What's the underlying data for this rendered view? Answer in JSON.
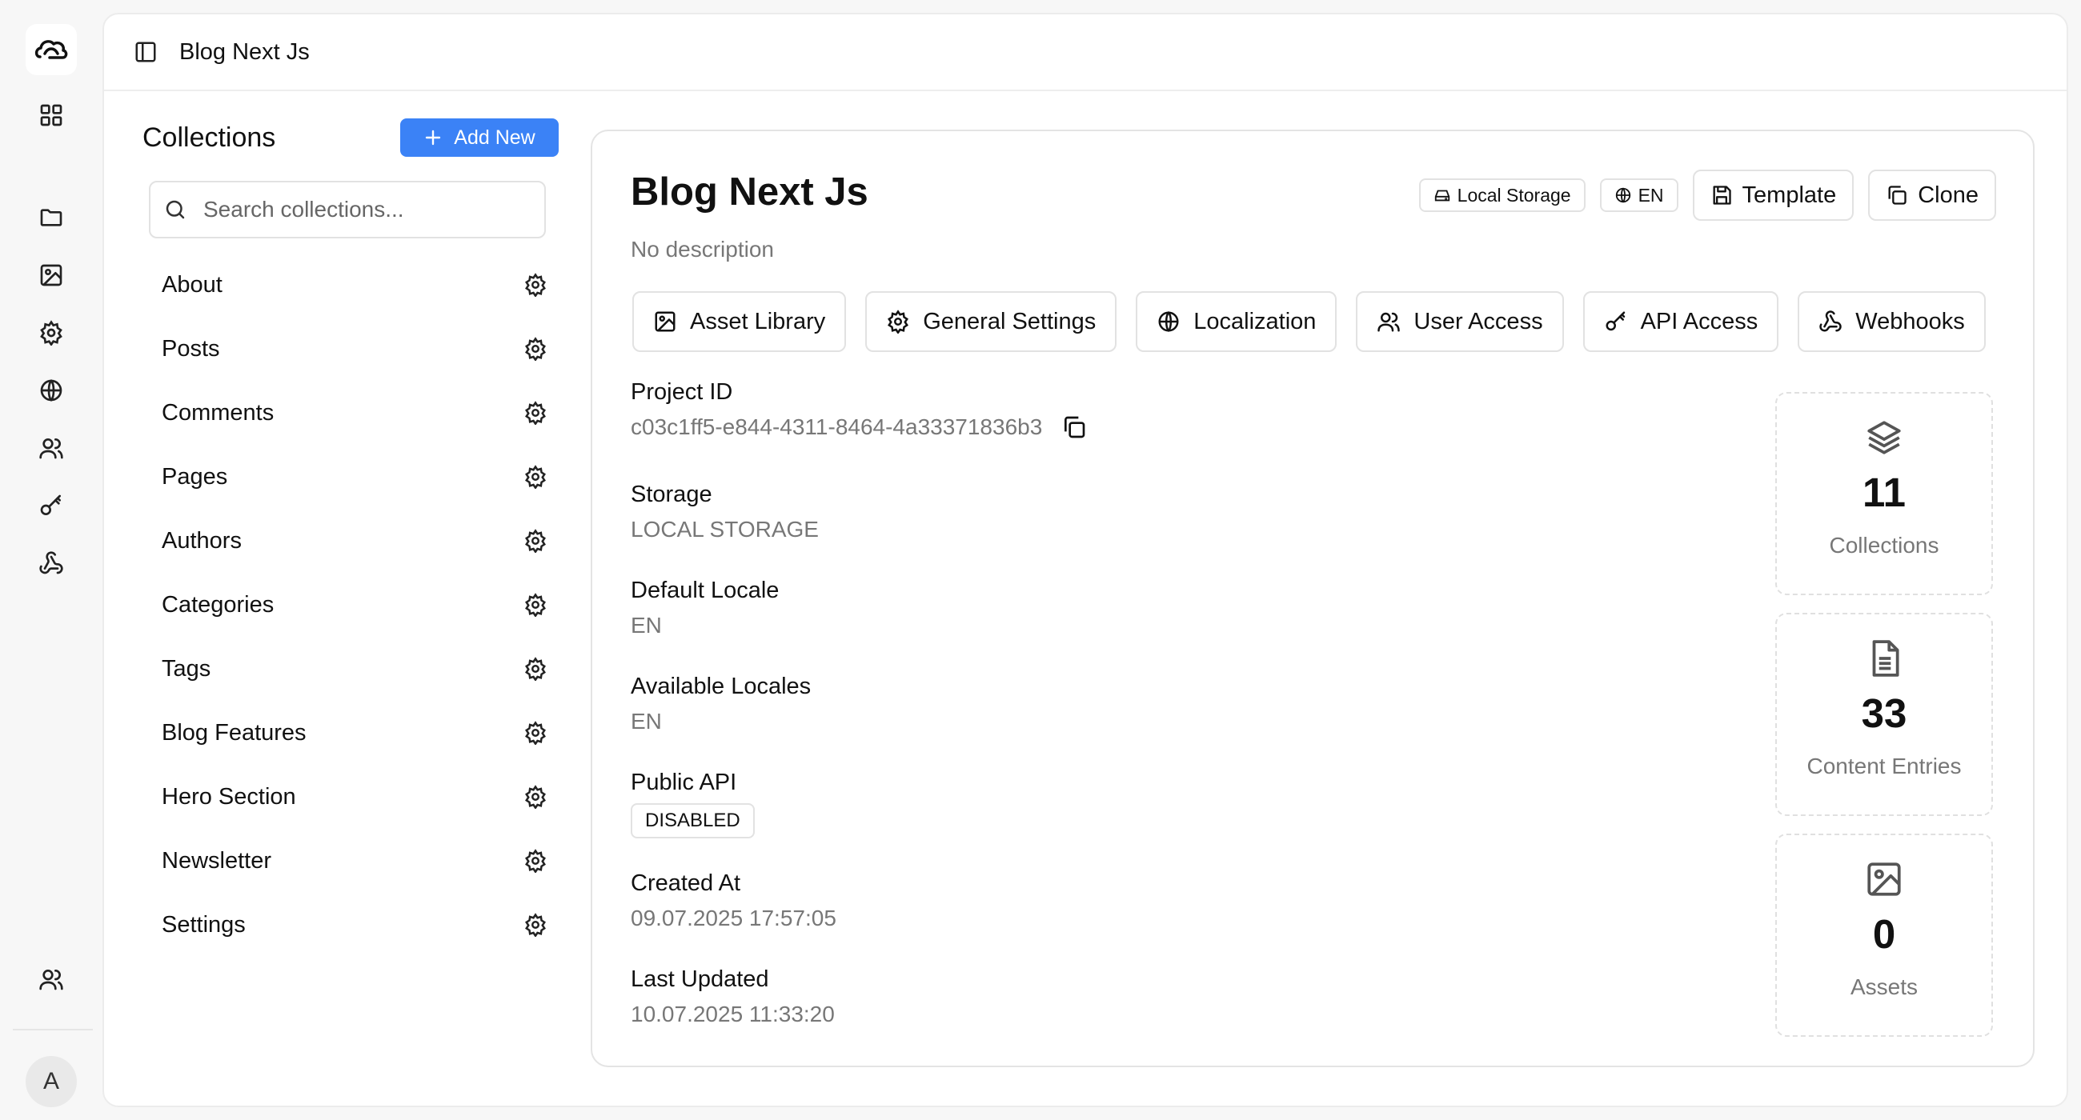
{
  "rail": {
    "icons": [
      "dashboard-icon",
      "folder-icon",
      "image-icon",
      "settings-icon",
      "globe-icon",
      "users-icon",
      "key-icon",
      "webhook-icon"
    ],
    "bottom_icon": "users-icon",
    "avatar_letter": "A"
  },
  "topbar": {
    "title": "Blog Next Js"
  },
  "collections": {
    "heading": "Collections",
    "add_label": "Add New",
    "search_placeholder": "Search collections...",
    "items": [
      {
        "label": "About"
      },
      {
        "label": "Posts"
      },
      {
        "label": "Comments"
      },
      {
        "label": "Pages"
      },
      {
        "label": "Authors"
      },
      {
        "label": "Categories"
      },
      {
        "label": "Tags"
      },
      {
        "label": "Blog Features"
      },
      {
        "label": "Hero Section"
      },
      {
        "label": "Newsletter"
      },
      {
        "label": "Settings"
      }
    ]
  },
  "project": {
    "title": "Blog Next Js",
    "description": "No description",
    "storage_pill": "Local Storage",
    "locale_pill": "EN",
    "template_label": "Template",
    "clone_label": "Clone",
    "tabs": [
      {
        "label": "Asset Library",
        "icon": "image-icon"
      },
      {
        "label": "General Settings",
        "icon": "settings-icon"
      },
      {
        "label": "Localization",
        "icon": "globe-icon"
      },
      {
        "label": "User Access",
        "icon": "users-icon"
      },
      {
        "label": "API Access",
        "icon": "key-icon"
      },
      {
        "label": "Webhooks",
        "icon": "webhook-icon"
      }
    ],
    "fields": {
      "project_id_label": "Project ID",
      "project_id_value": "c03c1ff5-e844-4311-8464-4a33371836b3",
      "storage_label": "Storage",
      "storage_value": "LOCAL STORAGE",
      "default_locale_label": "Default Locale",
      "default_locale_value": "EN",
      "available_locales_label": "Available Locales",
      "available_locales_value": "EN",
      "public_api_label": "Public API",
      "public_api_value": "DISABLED",
      "created_label": "Created At",
      "created_value": "09.07.2025 17:57:05",
      "updated_label": "Last Updated",
      "updated_value": "10.07.2025 11:33:20"
    },
    "stats": [
      {
        "value": "11",
        "label": "Collections",
        "icon": "layers-icon"
      },
      {
        "value": "33",
        "label": "Content Entries",
        "icon": "file-text-icon"
      },
      {
        "value": "0",
        "label": "Assets",
        "icon": "image-icon"
      }
    ]
  }
}
